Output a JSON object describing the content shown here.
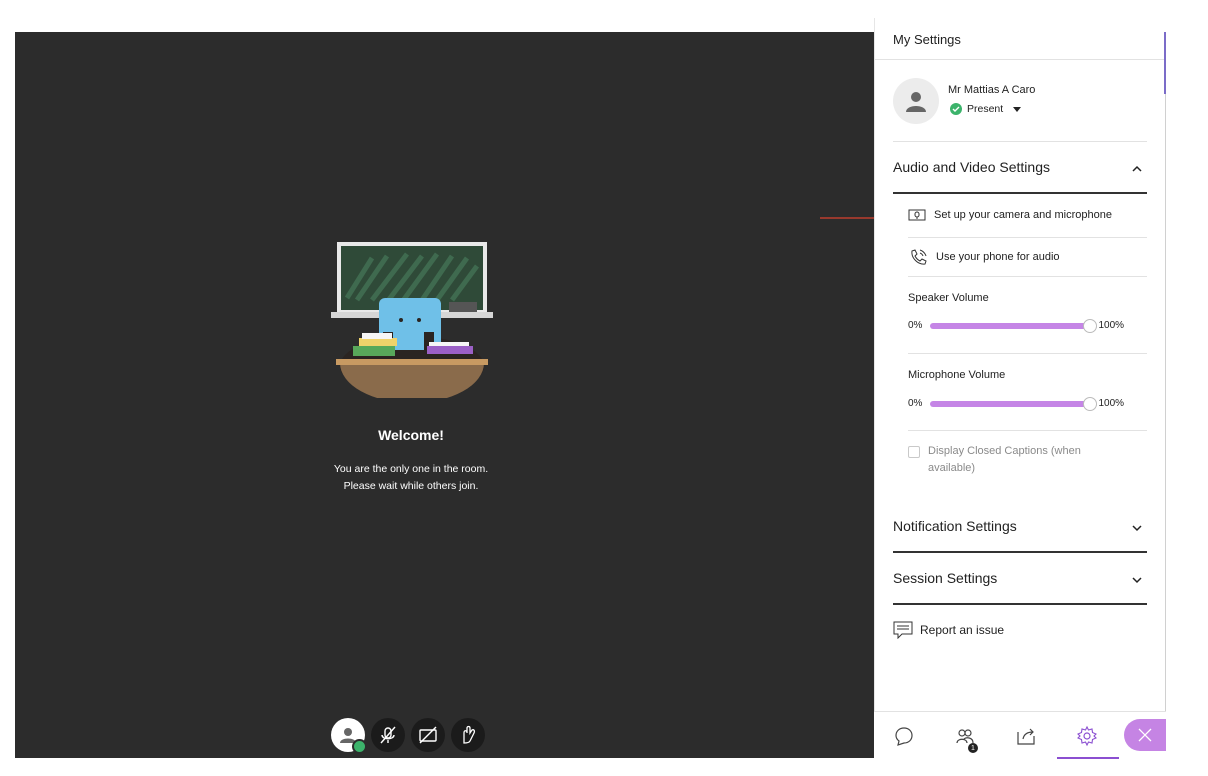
{
  "stage": {
    "welcome_title": "Welcome!",
    "welcome_line1": "You are the only one in the room.",
    "welcome_line2": "Please wait while others join."
  },
  "toolbar": {
    "items": [
      "avatar-status-icon",
      "microphone-off-icon",
      "camera-off-icon",
      "raise-hand-icon"
    ]
  },
  "panel": {
    "title": "My Settings",
    "user": {
      "name": "Mr Mattias A Caro",
      "status": "Present"
    },
    "audio_video": {
      "header": "Audio and Video Settings",
      "camera_mic": "Set up your camera and microphone",
      "phone_audio": "Use your phone for audio",
      "speaker_label": "Speaker Volume",
      "speaker_min": "0%",
      "speaker_max": "100%",
      "speaker_level": 1.0,
      "mic_label": "Microphone Volume",
      "mic_min": "0%",
      "mic_max": "100%",
      "mic_level": 1.0,
      "captions_line1": "Display Closed Captions (when",
      "captions_line2": "available)"
    },
    "notification_header": "Notification Settings",
    "session_header": "Session Settings",
    "report_issue": "Report an issue"
  },
  "bottom_bar": {
    "attendee_count": "1",
    "items": [
      "chat-icon",
      "attendees-icon",
      "share-content-icon",
      "settings-icon",
      "close-icon"
    ]
  },
  "colors": {
    "accent": "#c585e6",
    "present": "#3cb36b",
    "stage_bg": "#2c2c2c",
    "arrow": "#d9412e"
  }
}
